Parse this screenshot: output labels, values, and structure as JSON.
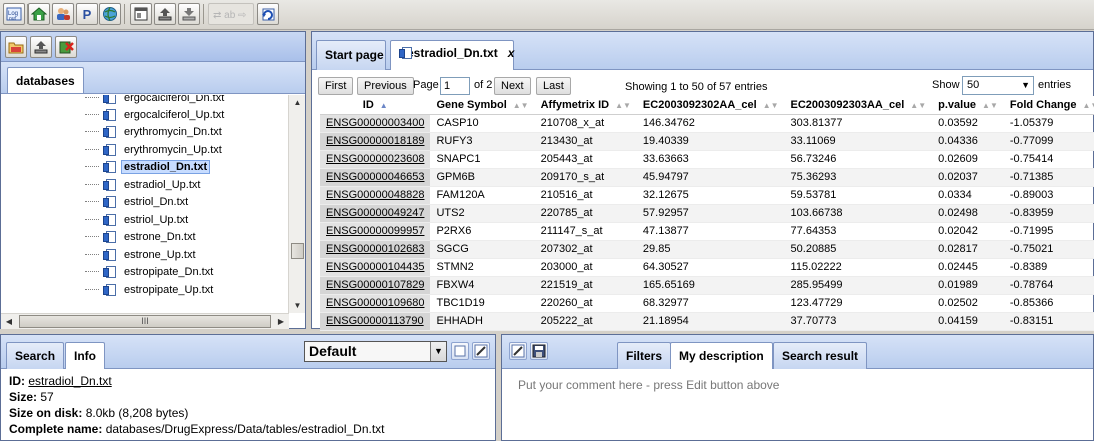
{
  "toolbar": {
    "icons": [
      "logout-icon",
      "home-icon",
      "users-icon",
      "p-icon",
      "globe-icon",
      "window-icon",
      "upload-icon",
      "download-icon",
      "disabled-arrows-icon",
      "refresh-icon"
    ],
    "p_label": "P"
  },
  "left": {
    "tab_databases": "databases",
    "tree_items": [
      {
        "label": "ergocalciferol_Dn.txt"
      },
      {
        "label": "ergocalciferol_Up.txt"
      },
      {
        "label": "erythromycin_Dn.txt"
      },
      {
        "label": "erythromycin_Up.txt"
      },
      {
        "label": "estradiol_Dn.txt",
        "selected": true
      },
      {
        "label": "estradiol_Up.txt"
      },
      {
        "label": "estriol_Dn.txt"
      },
      {
        "label": "estriol_Up.txt"
      },
      {
        "label": "estrone_Dn.txt"
      },
      {
        "label": "estrone_Up.txt"
      },
      {
        "label": "estropipate_Dn.txt"
      },
      {
        "label": "estropipate_Up.txt"
      }
    ],
    "hscroll_grip": "III"
  },
  "right": {
    "tab_start": "Start page",
    "tab_file": "estradiol_Dn.txt",
    "tab_close": "x",
    "pager": {
      "first": "First",
      "previous": "Previous",
      "page_label": "Page",
      "page_value": "1",
      "of_label": "of 2",
      "next": "Next",
      "last": "Last",
      "showing": "Showing 1 to 50 of 57 entries",
      "show_label": "Show",
      "show_value": "50",
      "entries_label": "entries"
    },
    "columns": [
      "ID",
      "Gene Symbol",
      "Affymetrix ID",
      "EC2003092302AA_cel",
      "EC2003092303AA_cel",
      "p.value",
      "Fold Change"
    ],
    "rows": [
      [
        "ENSG00000003400",
        "CASP10",
        "210708_x_at",
        "146.34762",
        "303.81377",
        "0.03592",
        "-1.05379"
      ],
      [
        "ENSG00000018189",
        "RUFY3",
        "213430_at",
        "19.40339",
        "33.11069",
        "0.04336",
        "-0.77099"
      ],
      [
        "ENSG00000023608",
        "SNAPC1",
        "205443_at",
        "33.63663",
        "56.73246",
        "0.02609",
        "-0.75414"
      ],
      [
        "ENSG00000046653",
        "GPM6B",
        "209170_s_at",
        "45.94797",
        "75.36293",
        "0.02037",
        "-0.71385"
      ],
      [
        "ENSG00000048828",
        "FAM120A",
        "210516_at",
        "32.12675",
        "59.53781",
        "0.0334",
        "-0.89003"
      ],
      [
        "ENSG00000049247",
        "UTS2",
        "220785_at",
        "57.92957",
        "103.66738",
        "0.02498",
        "-0.83959"
      ],
      [
        "ENSG00000099957",
        "P2RX6",
        "211147_s_at",
        "47.13877",
        "77.64353",
        "0.02042",
        "-0.71995"
      ],
      [
        "ENSG00000102683",
        "SGCG",
        "207302_at",
        "29.85",
        "50.20885",
        "0.02817",
        "-0.75021"
      ],
      [
        "ENSG00000104435",
        "STMN2",
        "203000_at",
        "64.30527",
        "115.02222",
        "0.02445",
        "-0.8389"
      ],
      [
        "ENSG00000107829",
        "FBXW4",
        "221519_at",
        "165.65169",
        "285.95499",
        "0.01989",
        "-0.78764"
      ],
      [
        "ENSG00000109680",
        "TBC1D19",
        "220260_at",
        "68.32977",
        "123.47729",
        "0.02502",
        "-0.85366"
      ],
      [
        "ENSG00000113790",
        "EHHADH",
        "205222_at",
        "21.18954",
        "37.70773",
        "0.04159",
        "-0.83151"
      ]
    ]
  },
  "bottom_left": {
    "tab_search": "Search",
    "tab_info": "Info",
    "dropdown_value": "Default",
    "info": {
      "id_label": "ID:",
      "id_value": "estradiol_Dn.txt",
      "size_label": "Size:",
      "size_value": "57",
      "disk_label": "Size on disk:",
      "disk_value": "8.0kb (8,208 bytes)",
      "name_label": "Complete name:",
      "name_value": "databases/DrugExpress/Data/tables/estradiol_Dn.txt"
    }
  },
  "bottom_right": {
    "tab_filters": "Filters",
    "tab_description": "My description",
    "tab_search_result": "Search result",
    "comment_placeholder": "Put your comment here - press Edit button above"
  }
}
